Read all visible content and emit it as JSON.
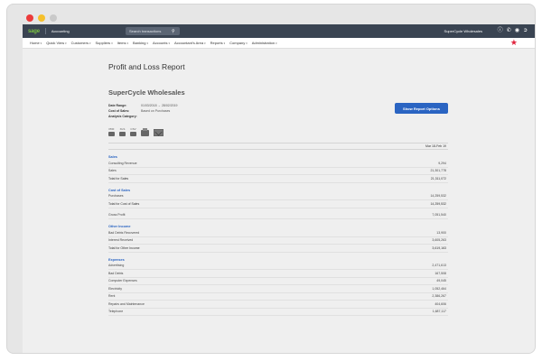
{
  "topbar": {
    "logo": "sage",
    "product": "Accounting",
    "search_placeholder": "Search transactions",
    "company": "SuperCycle Wholesales"
  },
  "nav": [
    "Home",
    "Quick View",
    "Customers",
    "Suppliers",
    "Items",
    "Banking",
    "Accounts",
    "Accountant's Area",
    "Reports",
    "Company",
    "Administration"
  ],
  "report": {
    "title": "Profit and Loss Report",
    "company": "SuperCycle Wholesales",
    "meta": [
      {
        "label": "Date Range:",
        "value": "01/03/2018 → 28/02/2019"
      },
      {
        "label": "Cost of Sales:",
        "value": "Based on Purchases"
      },
      {
        "label": "Analysis Category:",
        "value": ""
      }
    ],
    "options_button": "Show Report Options",
    "exports": [
      "PDF",
      "XLS",
      "CSV"
    ],
    "column_header": "Mar 18-Feb 19",
    "sections": [
      {
        "title": "Sales",
        "rows": [
          {
            "label": "Consulting Revenue",
            "value": "9,294"
          },
          {
            "label": "Sales",
            "value": "21,301,778"
          },
          {
            "label": "Total for Sales",
            "value": "21,311,072"
          }
        ]
      },
      {
        "title": "Cost of Sales",
        "rows": [
          {
            "label": "Purchases",
            "value": "14,259,532"
          },
          {
            "label": "Total for Cost of Sales",
            "value": "14,259,532"
          }
        ]
      },
      {
        "title": "",
        "rows": [
          {
            "label": "Gross Profit",
            "value": "7,051,540"
          }
        ]
      },
      {
        "title": "Other Income",
        "rows": [
          {
            "label": "Bad Debts Recovered",
            "value": "13,900"
          },
          {
            "label": "Interest Received",
            "value": "3,605,263"
          },
          {
            "label": "Total for Other Income",
            "value": "3,619,163"
          }
        ]
      },
      {
        "title": "Expenses",
        "rows": [
          {
            "label": "Advertising",
            "value": "2,471,613"
          },
          {
            "label": "Bad Debts",
            "value": "167,508"
          },
          {
            "label": "Computer Expenses",
            "value": "49,045"
          },
          {
            "label": "Electricity",
            "value": "1,052,464"
          },
          {
            "label": "Rent",
            "value": "2,386,267"
          },
          {
            "label": "Repairs and Maintenance",
            "value": "404,606"
          },
          {
            "label": "Telephone",
            "value": "1,687,117"
          }
        ]
      }
    ]
  }
}
